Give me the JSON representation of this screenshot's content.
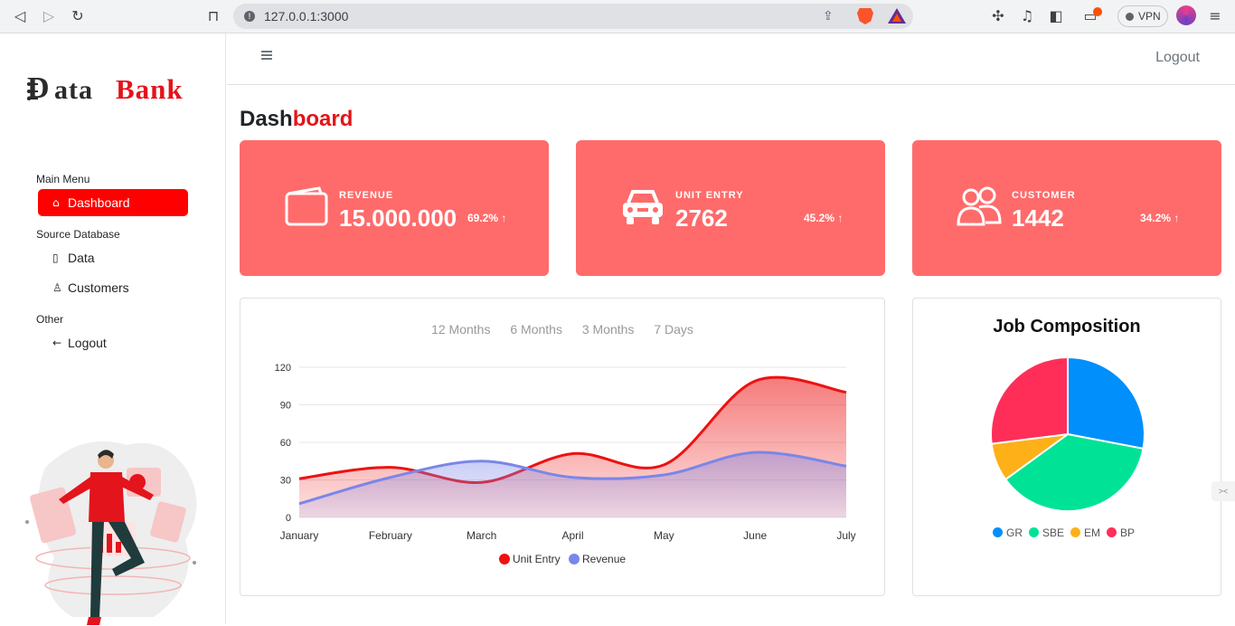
{
  "browser": {
    "url": "127.0.0.1:3000",
    "vpn_label": "VPN",
    "icons": [
      "back-icon",
      "forward-icon",
      "reload-icon",
      "bookmark-icon",
      "share-icon",
      "brave-shield-icon",
      "bat-rewards-icon",
      "extensions-icon",
      "music-icon",
      "sidebar-icon",
      "wallet-icon",
      "menu-icon"
    ]
  },
  "sidebar": {
    "logo_d": "D",
    "logo_ata": "ata",
    "logo_bank": "Bank",
    "section_main": "Main Menu",
    "section_source": "Source Database",
    "section_other": "Other",
    "items": [
      {
        "label": "Dashboard",
        "icon": "home-icon",
        "active": true
      },
      {
        "label": "Data",
        "icon": "file-icon",
        "active": false
      },
      {
        "label": "Customers",
        "icon": "person-icon",
        "active": false
      },
      {
        "label": "Logout",
        "icon": "arrow-left-icon",
        "active": false
      }
    ]
  },
  "topbar": {
    "logout_label": "Logout"
  },
  "page_title": {
    "part1": "Dash",
    "part2": "board"
  },
  "cards": [
    {
      "label": "REVENUE",
      "value": "15.000.000",
      "percent": "69.2%",
      "icon": "wallet-icon"
    },
    {
      "label": "UNIT ENTRY",
      "value": "2762",
      "percent": "45.2%",
      "icon": "car-icon"
    },
    {
      "label": "CUSTOMER",
      "value": "1442",
      "percent": "34.2%",
      "icon": "people-icon"
    }
  ],
  "colors": {
    "card_bg": "#ff6b6b",
    "accent": "#e3141c",
    "active_nav": "#ff0000"
  },
  "filters": [
    "12 Months",
    "6 Months",
    "3 Months",
    "7 Days"
  ],
  "chart_data": [
    {
      "type": "area",
      "categories": [
        "January",
        "February",
        "March",
        "April",
        "May",
        "June",
        "July"
      ],
      "series": [
        {
          "name": "Unit Entry",
          "values": [
            31,
            40,
            28,
            51,
            42,
            109,
            100
          ],
          "color": "#ee1111"
        },
        {
          "name": "Revenue",
          "values": [
            11,
            32,
            45,
            32,
            34,
            52,
            41
          ],
          "color": "#7b86e8"
        }
      ],
      "ylim": [
        0,
        120
      ],
      "yticks": [
        "0",
        "30",
        "60",
        "90",
        "120"
      ],
      "grid": true,
      "legend": "bottom"
    },
    {
      "type": "pie",
      "title": "Job Composition",
      "labels": [
        "GR",
        "SBE",
        "EM",
        "BP"
      ],
      "values": [
        28,
        37,
        8,
        27
      ],
      "colors": [
        "#008ffb",
        "#00e396",
        "#feb019",
        "#ff2e58"
      ],
      "legend": "bottom"
    }
  ]
}
